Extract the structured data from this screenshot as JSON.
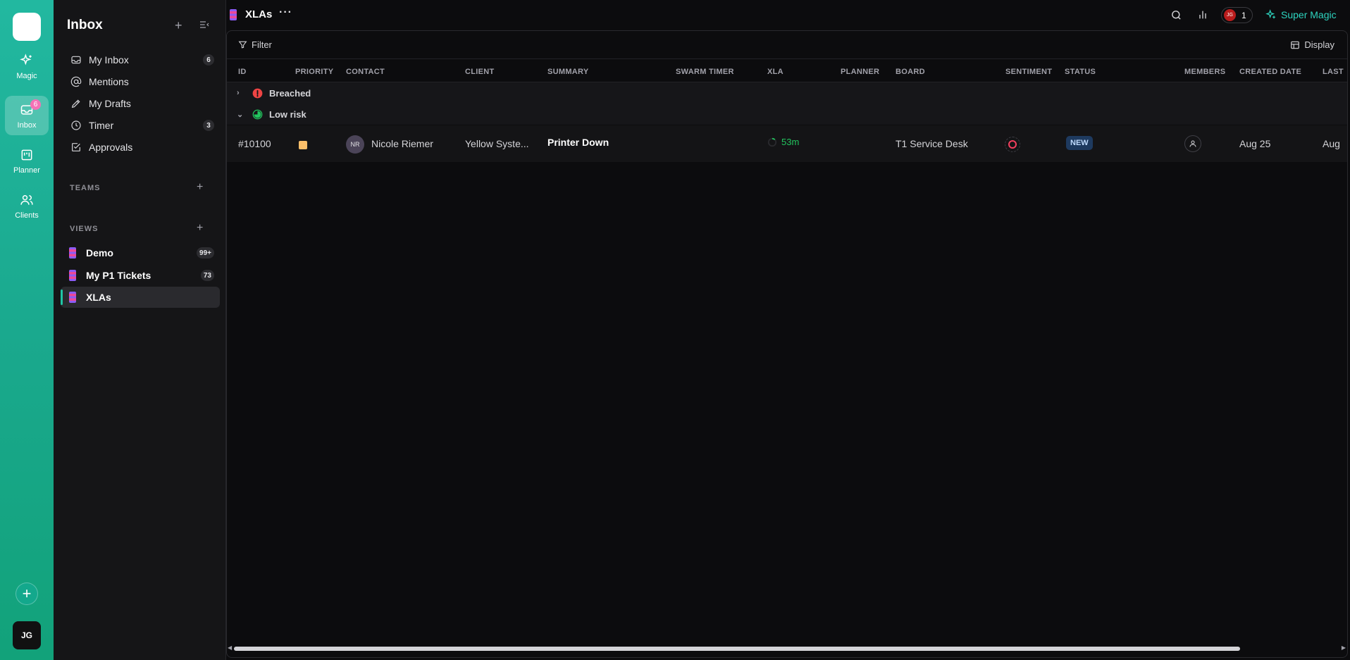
{
  "rail": {
    "items": [
      {
        "label": "Magic",
        "icon": "sparkle-icon"
      },
      {
        "label": "Inbox",
        "icon": "inbox-icon",
        "badge": "6"
      },
      {
        "label": "Planner",
        "icon": "planner-icon"
      },
      {
        "label": "Clients",
        "icon": "users-icon"
      }
    ],
    "avatar": "JG"
  },
  "sidebar": {
    "title": "Inbox",
    "nav": [
      {
        "label": "My Inbox",
        "count": "6"
      },
      {
        "label": "Mentions",
        "count": ""
      },
      {
        "label": "My Drafts",
        "count": ""
      },
      {
        "label": "Timer",
        "count": "3"
      },
      {
        "label": "Approvals",
        "count": ""
      }
    ],
    "teams_label": "TEAMS",
    "views_label": "VIEWS",
    "views": [
      {
        "label": "Demo",
        "count": "99+"
      },
      {
        "label": "My P1 Tickets",
        "count": "73"
      },
      {
        "label": "XLAs",
        "count": ""
      }
    ]
  },
  "topbar": {
    "title": "XLAs",
    "more": "···",
    "presence_initials": "JG",
    "presence_count": "1",
    "super_magic": "Super Magic"
  },
  "toolbar": {
    "filter": "Filter",
    "display": "Display"
  },
  "table": {
    "columns": [
      "ID",
      "PRIORITY",
      "CONTACT",
      "CLIENT",
      "SUMMARY",
      "SWARM TIMER",
      "XLA",
      "PLANNER",
      "BOARD",
      "SENTIMENT",
      "STATUS",
      "MEMBERS",
      "CREATED DATE",
      "LAST"
    ],
    "groups": [
      {
        "label": "Breached",
        "expanded": false
      },
      {
        "label": "Low risk",
        "expanded": true
      }
    ],
    "rows": [
      {
        "id": "#10100",
        "priority_color": "#fbbf6a",
        "contact_initials": "NR",
        "contact": "Nicole Riemer",
        "client": "Yellow Syste...",
        "summary": "Printer Down",
        "xla": "53m",
        "board": "T1 Service Desk",
        "status": "NEW",
        "created": "Aug 25",
        "last": "Aug"
      }
    ]
  }
}
